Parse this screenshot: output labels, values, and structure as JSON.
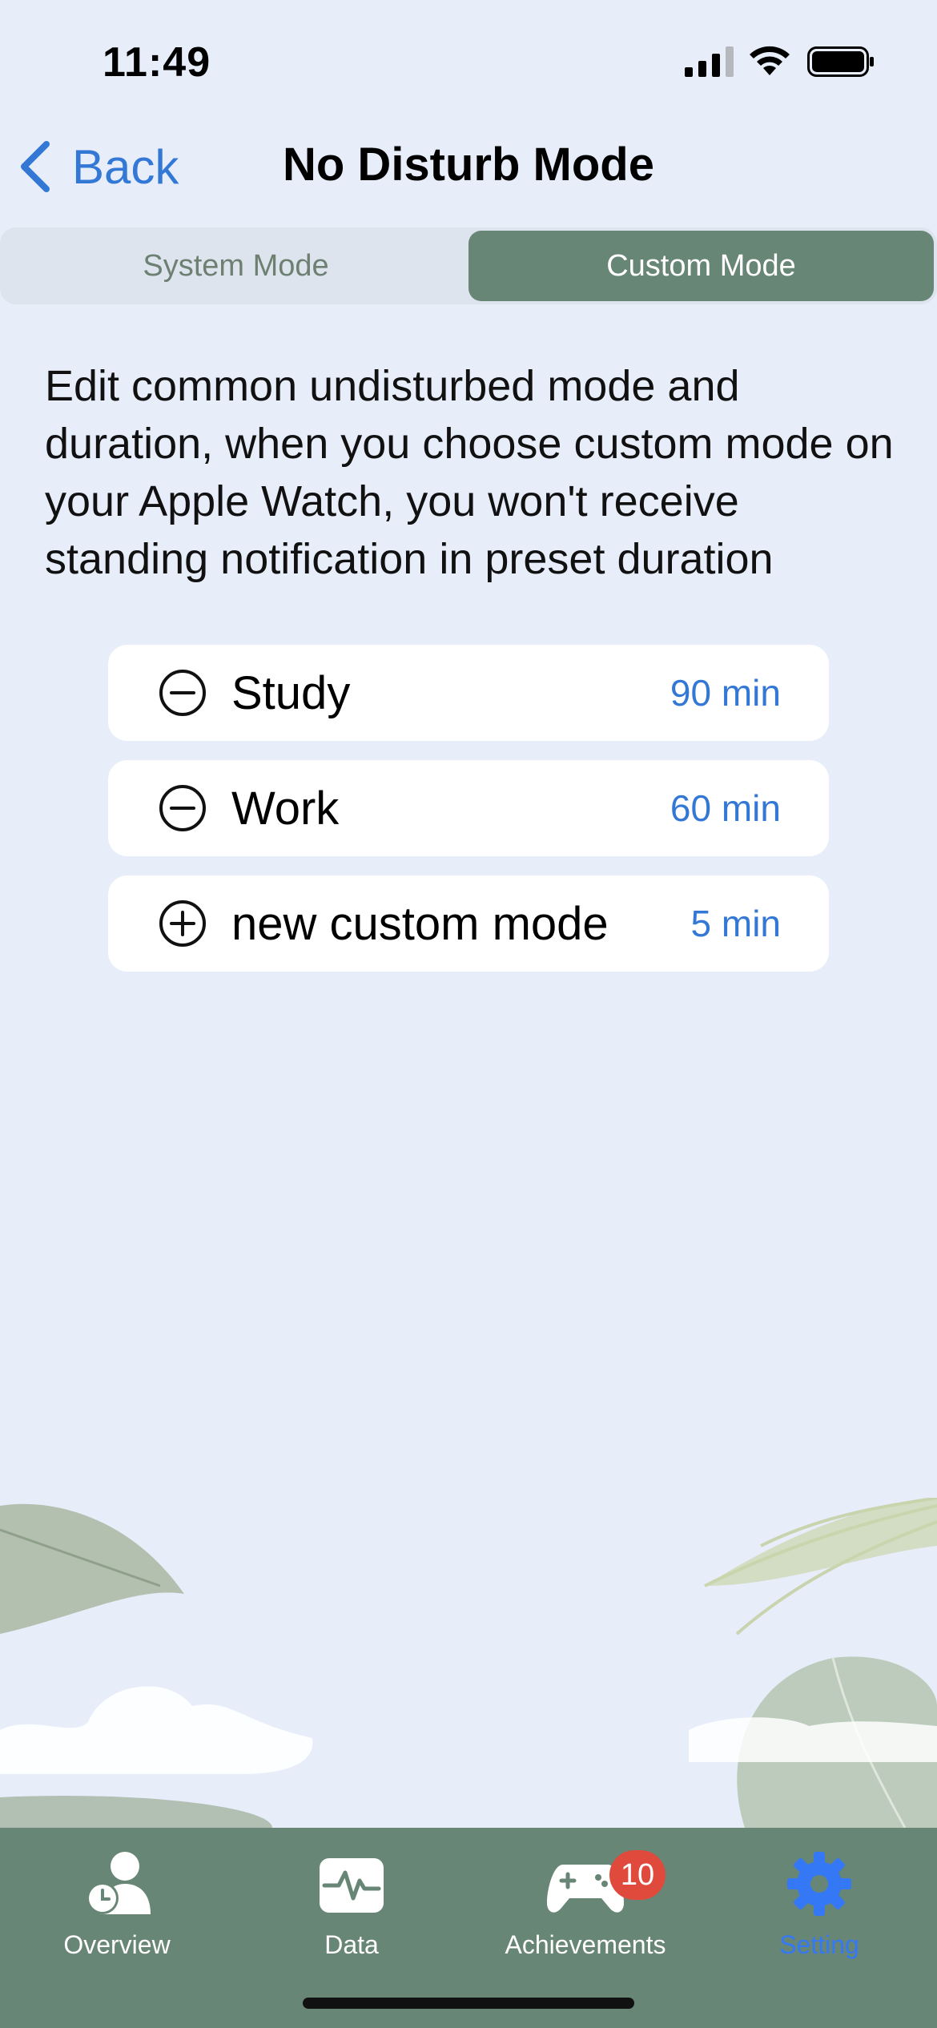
{
  "status_bar": {
    "time": "11:49"
  },
  "nav": {
    "back_label": "Back",
    "title": "No Disturb Mode"
  },
  "segments": {
    "system": "System Mode",
    "custom": "Custom Mode",
    "selected": "Custom Mode"
  },
  "description": "Edit common undisturbed mode and duration, when you choose custom mode on your Apple Watch, you won't receive standing notification in preset duration",
  "modes": [
    {
      "icon": "minus-circle-icon",
      "name": "Study",
      "duration": "90 min"
    },
    {
      "icon": "minus-circle-icon",
      "name": "Work",
      "duration": "60 min"
    },
    {
      "icon": "plus-circle-icon",
      "name": "new custom mode",
      "duration": "5 min"
    }
  ],
  "tabs": [
    {
      "icon": "overview-icon",
      "label": "Overview"
    },
    {
      "icon": "data-icon",
      "label": "Data"
    },
    {
      "icon": "gamepad-icon",
      "label": "Achievements",
      "badge": "10"
    },
    {
      "icon": "gear-icon",
      "label": "Setting",
      "selected": true
    }
  ],
  "colors": {
    "accent": "#3478d6",
    "tab_bar": "#688676",
    "background": "#e7eefa",
    "badge": "#e04a3c"
  }
}
